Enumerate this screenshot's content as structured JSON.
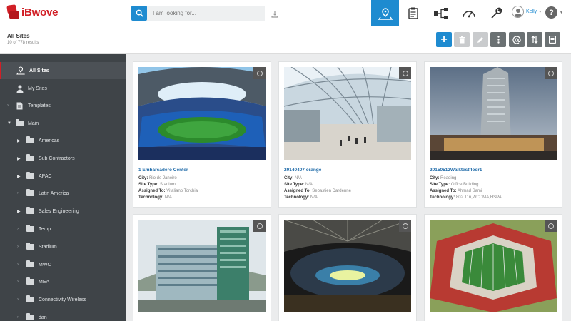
{
  "app": {
    "name": "iBwove"
  },
  "search": {
    "placeholder": "I am looking for..."
  },
  "user": {
    "name": "Kelly"
  },
  "help": {
    "label": "?"
  },
  "page": {
    "title": "All Sites",
    "count": "10 of 778 results"
  },
  "toolbar": {
    "add_label": "+"
  },
  "sidebar": {
    "items": [
      {
        "label": "All Sites"
      },
      {
        "label": "My Sites"
      },
      {
        "label": "Templates"
      },
      {
        "label": "Main"
      },
      {
        "label": "Americas"
      },
      {
        "label": "Sub Contractors"
      },
      {
        "label": "APAC"
      },
      {
        "label": "Latin America"
      },
      {
        "label": "Sales Engineering"
      },
      {
        "label": "Temp"
      },
      {
        "label": "Stadium"
      },
      {
        "label": "MWC"
      },
      {
        "label": "MEA"
      },
      {
        "label": "Connectivity Wireless"
      },
      {
        "label": "dan"
      }
    ]
  },
  "field_labels": {
    "city": "City:",
    "site_type": "Site Type:",
    "assigned_to": "Assigned To:",
    "technology": "Technology:"
  },
  "cards": [
    {
      "title": "1 Embarcadero Center",
      "city": "Rio de Janeiro",
      "site_type": "Stadium",
      "assigned_to": "Vitaliano Torchia",
      "technology": "N/A"
    },
    {
      "title": "20140407 orange",
      "city": "N/A",
      "site_type": "N/A",
      "assigned_to": "Sebastien Dardenne",
      "technology": "N/A"
    },
    {
      "title": "20150512Walktestfloor1",
      "city": "Reading",
      "site_type": "Office Building",
      "assigned_to": "Ahmad Sami",
      "technology": "802.11n,WCDMA,HSPA"
    }
  ],
  "colors": {
    "accent": "#1e8bd0",
    "brand": "#d11f26",
    "sidebar": "#3f4448"
  }
}
